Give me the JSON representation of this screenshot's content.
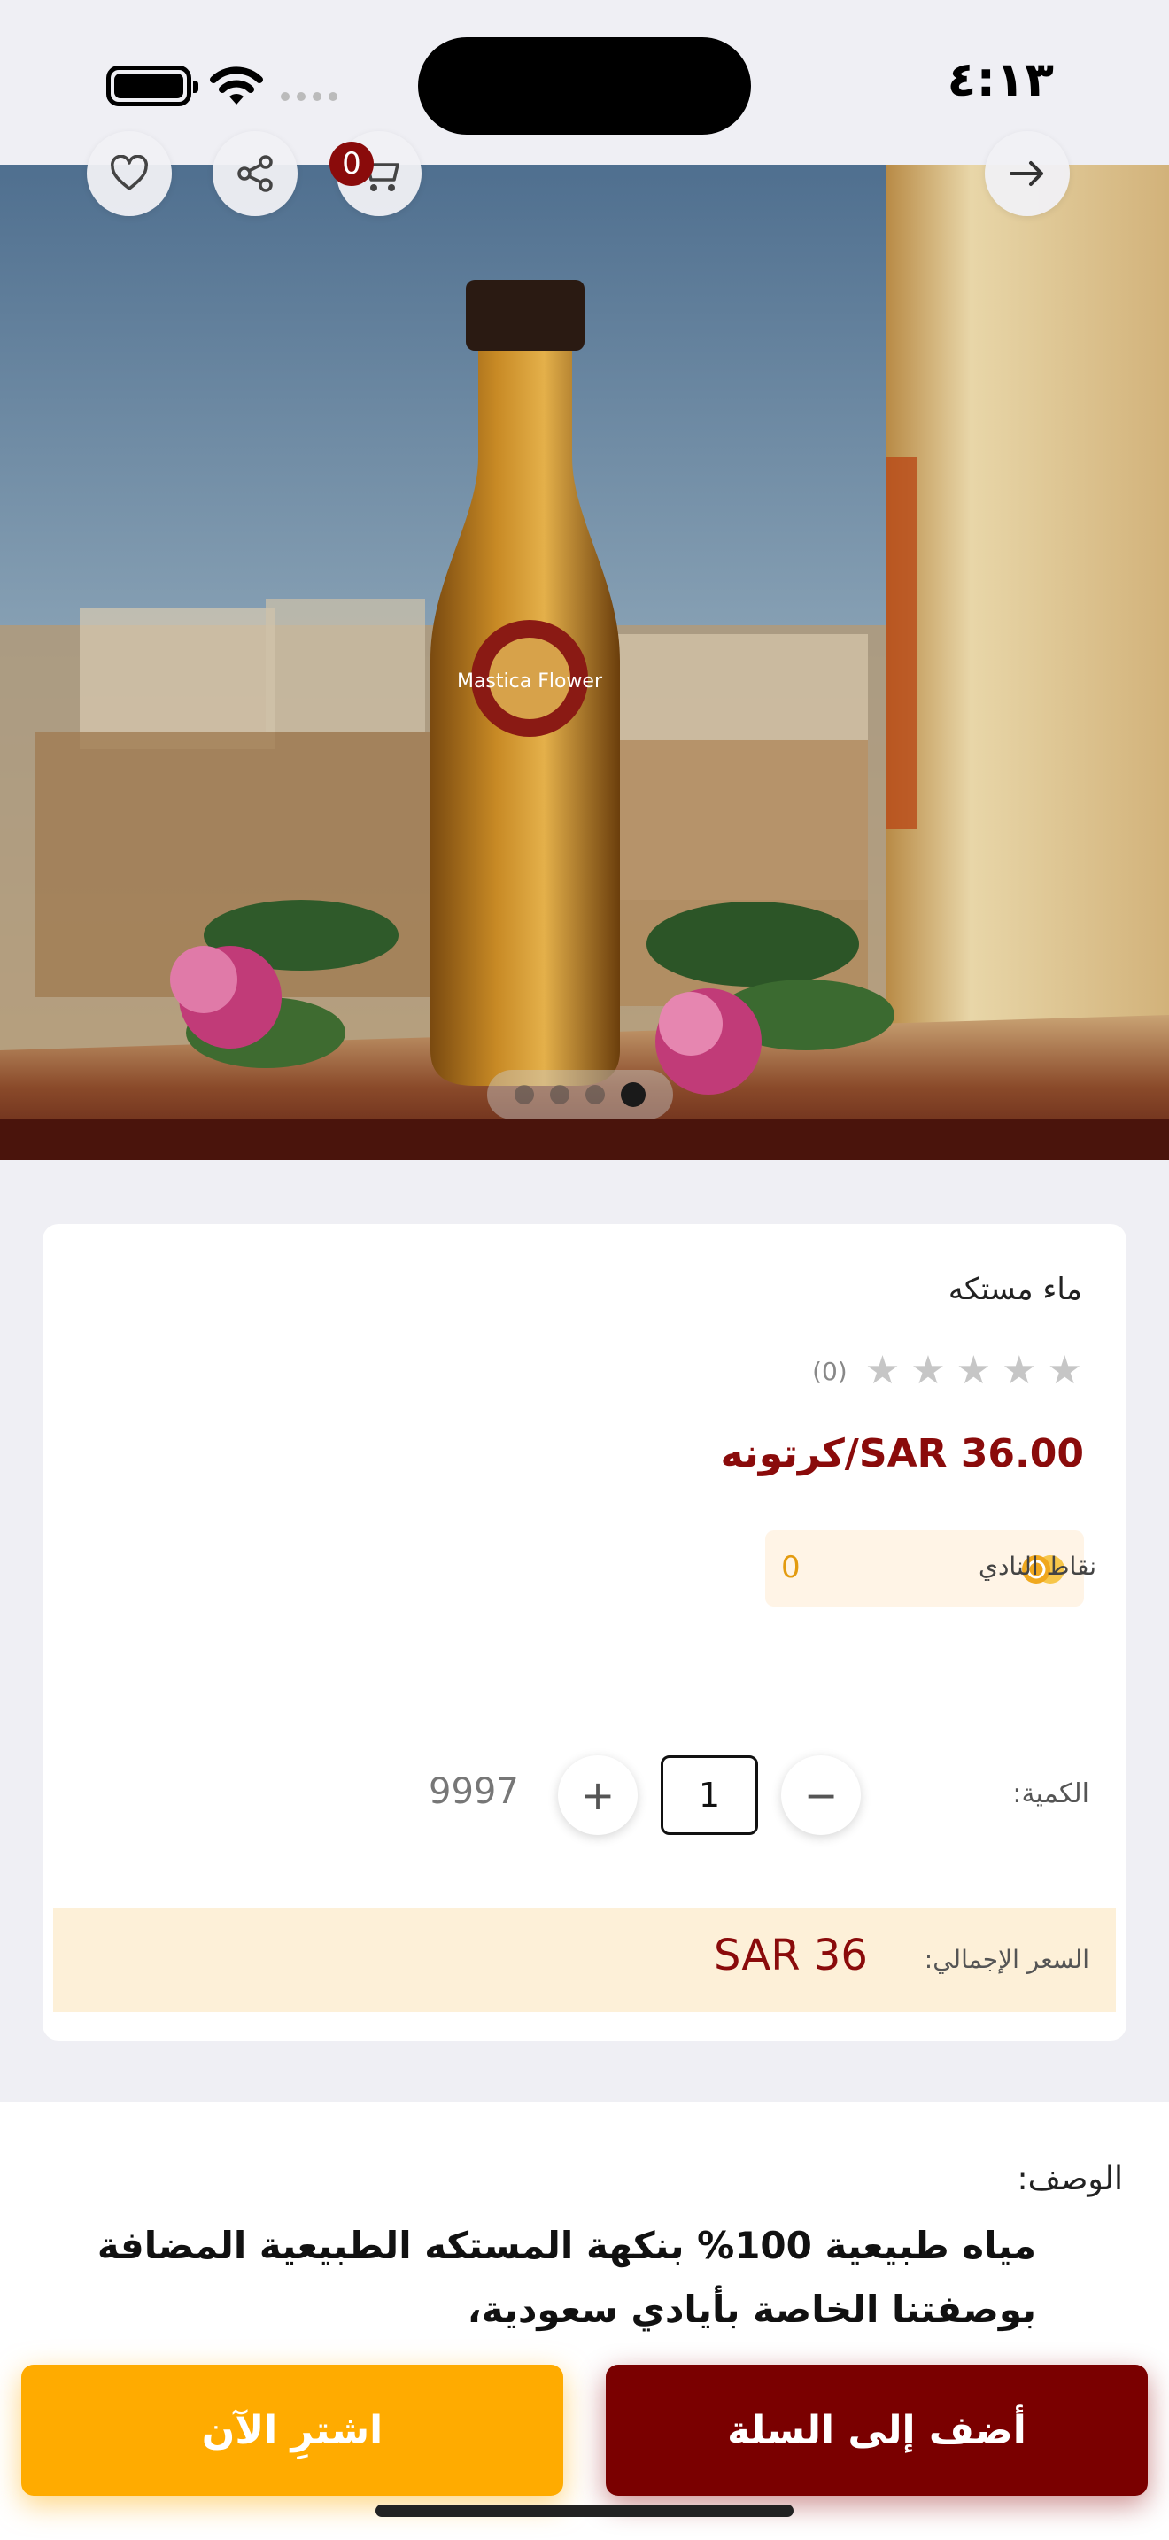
{
  "status_bar": {
    "time": "٤:١٣"
  },
  "product": {
    "name": "ماء مستكه",
    "rating_count": "(0)",
    "price": "SAR 36.00/كرتونه",
    "club_points": {
      "label": "نقاط النادي",
      "value": "0"
    },
    "quantity": {
      "label": "الكمية:",
      "value": "1",
      "plus": "+",
      "minus": "−",
      "stock": "9997"
    },
    "total": {
      "label": "السعر الإجمالي:",
      "value": "SAR 36"
    },
    "bottle_label_text": "Mastica Flower"
  },
  "header": {
    "cart_count": "0"
  },
  "gallery": {
    "image_count": 4,
    "active_index": 3
  },
  "description": {
    "title": "الوصف:",
    "body": "مياه طبيعية 100% بنكهة المستكه الطبيعية المضافة بوصفتنا الخاصة بأيادي سعودية،"
  },
  "actions": {
    "add_to_cart": "أضف إلى السلة",
    "buy_now": "اشترِ الآن"
  },
  "colors": {
    "brand": "#7a0000",
    "accent": "#ffab00",
    "price": "#8a0b0b",
    "points": "#e39b10"
  },
  "icons": [
    "heart-icon",
    "share-icon",
    "cart-icon",
    "arrow-right-icon",
    "star-icon",
    "medal-icon",
    "battery-icon",
    "wifi-icon",
    "signal-icon"
  ]
}
